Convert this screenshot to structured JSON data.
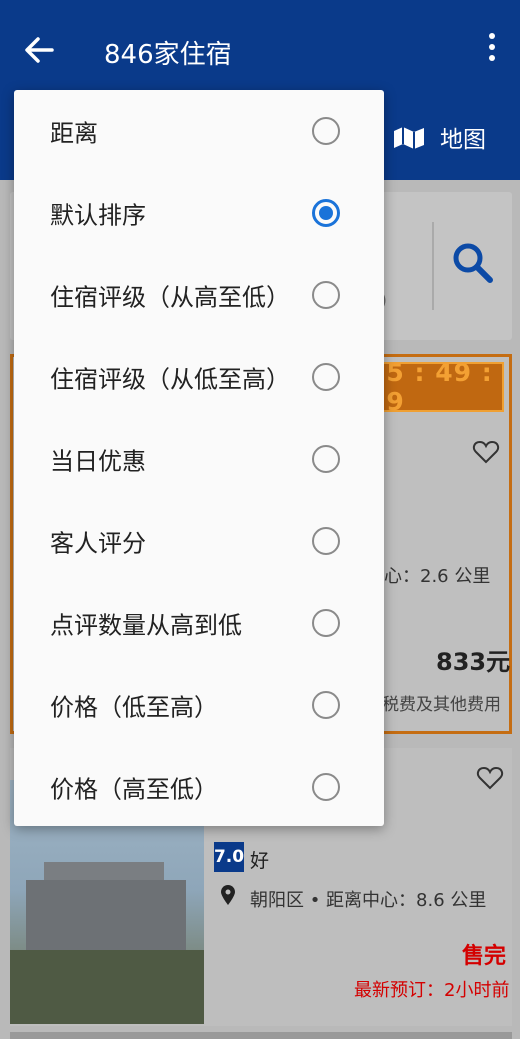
{
  "header": {
    "title": "846家住宿",
    "map_label": "地图",
    "bg_color": "#0a3a8a"
  },
  "search": {
    "hint_fragment": ")"
  },
  "deal": {
    "countdown": "15 : 49 : 59",
    "distance_fragment": "心：2.6 公里",
    "price": "833元",
    "tax_note": "税费及其他费用"
  },
  "hotel": {
    "score": "7.0",
    "score_label": "好",
    "location": "朝阳区 • 距离中心：8.6 公里",
    "status": "售完",
    "last_booking": "最新预订：2小时前"
  },
  "sort_menu": {
    "selected_index": 1,
    "accent_color": "#1a73d9",
    "items": [
      {
        "label": "距离"
      },
      {
        "label": "默认排序"
      },
      {
        "label": "住宿评级（从高至低）"
      },
      {
        "label": "住宿评级（从低至高）"
      },
      {
        "label": "当日优惠"
      },
      {
        "label": "客人评分"
      },
      {
        "label": "点评数量从高到低"
      },
      {
        "label": "价格（低至高）"
      },
      {
        "label": "价格（高至低）"
      }
    ]
  }
}
